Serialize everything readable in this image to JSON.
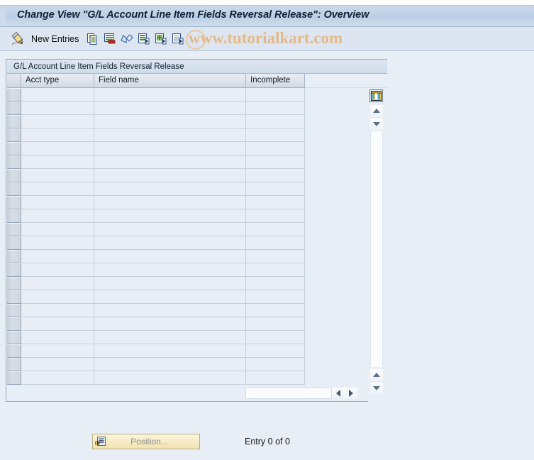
{
  "window": {
    "title": "Change View \"G/L Account Line Item Fields Reversal Release\": Overview"
  },
  "toolbar": {
    "pencil_icon": "pencil-display-change-icon",
    "new_entries_label": "New Entries",
    "icons": [
      {
        "name": "copy-icon",
        "title": "Copy As..."
      },
      {
        "name": "delete-icon",
        "title": "Delete"
      },
      {
        "name": "undo-icon",
        "title": "Undo Change"
      },
      {
        "name": "select-all-icon",
        "title": "Select All"
      },
      {
        "name": "select-block-icon",
        "title": "Select Block"
      },
      {
        "name": "deselect-all-icon",
        "title": "Deselect All"
      }
    ]
  },
  "watermark": {
    "text": "www.tutorialkart.com",
    "color": "#e2b98a"
  },
  "panel": {
    "title": "G/L Account Line Item Fields Reversal Release"
  },
  "table": {
    "columns": [
      {
        "key": "selector",
        "label": ""
      },
      {
        "key": "acct_type",
        "label": "Acct type"
      },
      {
        "key": "field_name",
        "label": "Field name"
      },
      {
        "key": "incomplete",
        "label": "Incomplete"
      }
    ],
    "rows": [],
    "empty_row_count": 22,
    "config_icon": "table-settings-icon"
  },
  "scrollbars": {
    "vertical_top_up": "scroll-up-arrow",
    "vertical_top_down": "scroll-down-arrow",
    "vertical_bottom_up": "scroll-up-arrow",
    "vertical_bottom_down": "scroll-down-arrow",
    "horizontal_left": "scroll-left-arrow",
    "horizontal_right": "scroll-right-arrow"
  },
  "footer": {
    "position_button_label": "Position...",
    "position_button_icon": "position-icon",
    "entry_status": "Entry 0 of 0"
  },
  "colors": {
    "window_bg": "#e8eef6",
    "titlebar": "#bed2e6",
    "toolbar": "#dde6f0",
    "grid_cell": "#e9eef6",
    "grid_border": "#c3cedb",
    "header_text": "#0d1a26",
    "button_yellow": "#f6ebc4"
  }
}
